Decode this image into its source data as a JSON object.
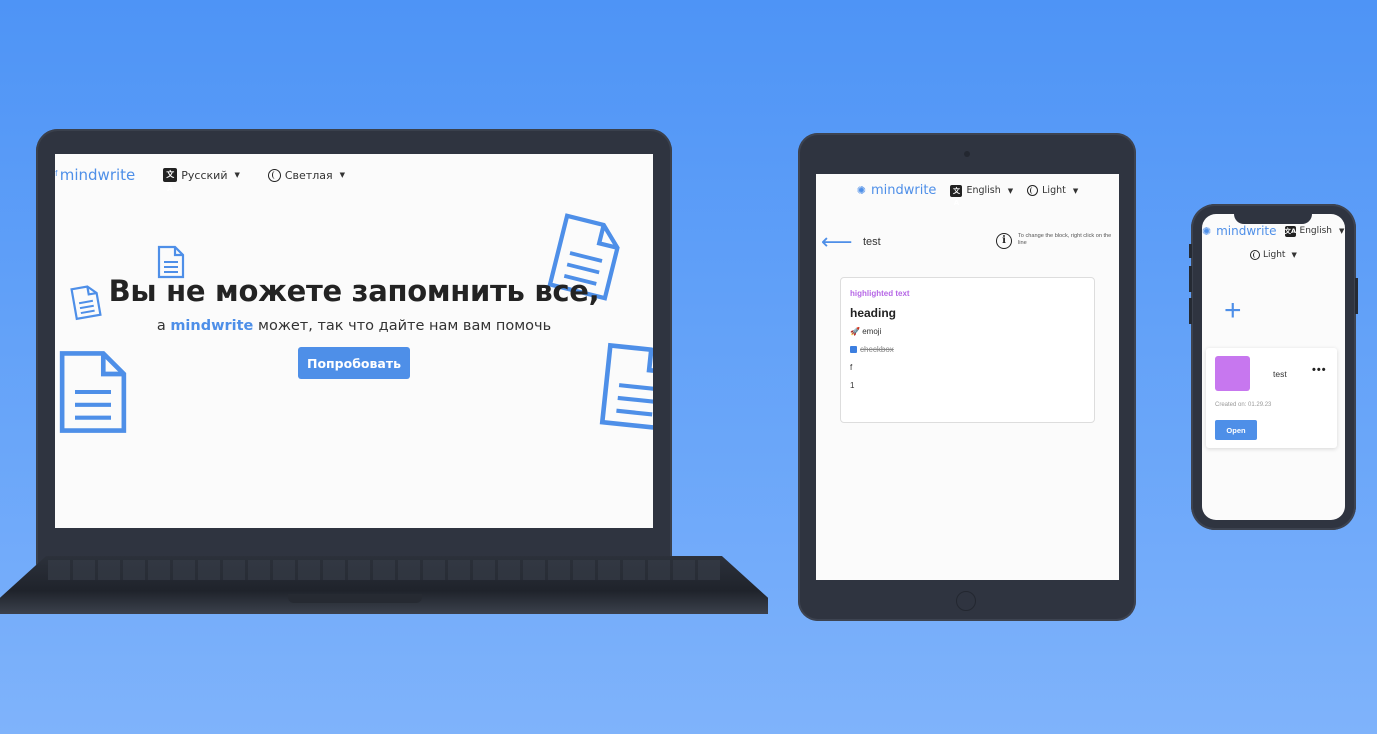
{
  "laptop": {
    "logo": "mindwrite",
    "language": "Русский",
    "theme": "Светлая",
    "hero_title": "Вы не можете запомнить все,",
    "hero_sub_prefix": "а",
    "hero_sub_brand": "mindwrite",
    "hero_sub_suffix": "может, так что дайте нам вам помочь",
    "cta_label": "Попробовать"
  },
  "tablet": {
    "logo": "mindwrite",
    "language": "English",
    "theme": "Light",
    "note_title": "test",
    "info_hint": "To change the block, right click on the line",
    "blocks": {
      "highlighted": "highlighted text",
      "heading": "heading",
      "emoji_text": "emoji",
      "checkbox_text": "checkbox",
      "line_f": "f",
      "line_1": "1"
    }
  },
  "phone": {
    "logo": "mindwrite",
    "language": "English",
    "theme": "Light",
    "note_title": "test",
    "created": "Created on: 01.29.23",
    "open_label": "Open"
  },
  "colors": {
    "background": "#4e94f6",
    "accent": "#4e8fe8",
    "highlight": "#b667e6",
    "thumbnail": "#c777ef",
    "device": "#2f3440"
  },
  "icons": [
    "translate-icon",
    "globe-icon",
    "document-icon",
    "info-icon",
    "back-arrow-icon",
    "plus-icon",
    "more-icon",
    "rocket-icon",
    "checkbox-icon"
  ]
}
